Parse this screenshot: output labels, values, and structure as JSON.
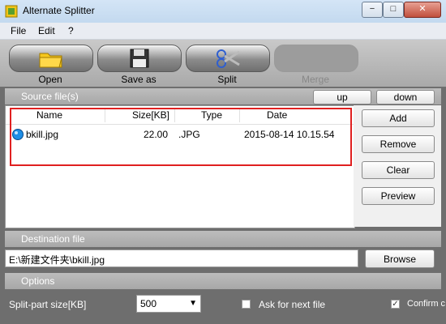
{
  "window": {
    "title": "Alternate Splitter",
    "minimize": "−",
    "maximize": "□",
    "close": "✕"
  },
  "menu": [
    "File",
    "Edit",
    "?"
  ],
  "toolbar": {
    "open": "Open",
    "save_as": "Save as",
    "split": "Split",
    "merge": "Merge"
  },
  "source": {
    "header": "Source file(s)",
    "up": "up",
    "down": "down",
    "columns": [
      "Name",
      "Size[KB]",
      "Type",
      "Date"
    ],
    "rows": [
      {
        "name": "bkill.jpg",
        "size": "22.00",
        "type": ".JPG",
        "date": "2015-08-14 10.15.54"
      }
    ],
    "buttons": {
      "add": "Add",
      "remove": "Remove",
      "clear": "Clear",
      "preview": "Preview"
    }
  },
  "destination": {
    "header": "Destination file",
    "value": "E:\\新建文件夹\\bkill.jpg",
    "browse": "Browse"
  },
  "options": {
    "header": "Options",
    "split_size_label": "Split-part size[KB]",
    "split_size_value": "500",
    "ask_next_label": "Ask for next file",
    "ask_next_checked": false,
    "confirm_label": "Confirm c",
    "confirm_checked": true
  }
}
